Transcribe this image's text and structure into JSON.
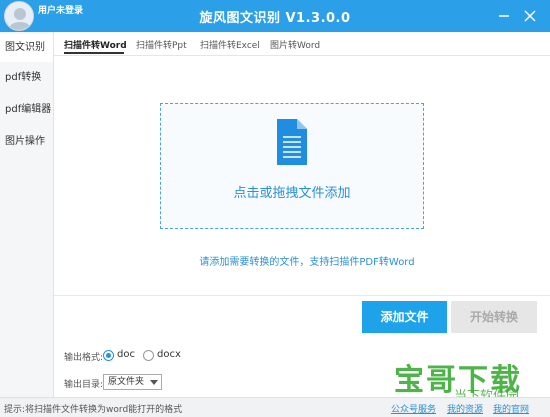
{
  "titlebar": {
    "user": "用户未登录",
    "title": "旋风图文识别 V1.3.0.0",
    "color": "#2b9fe8"
  },
  "sidebar": {
    "items": [
      {
        "label": "图文识别"
      },
      {
        "label": "pdf转换"
      },
      {
        "label": "pdf编辑器"
      },
      {
        "label": "图片操作"
      }
    ]
  },
  "tabs": [
    {
      "label": "扫描件转Word"
    },
    {
      "label": "扫描件转Ppt"
    },
    {
      "label": "扫描件转Excel"
    },
    {
      "label": "图片转Word"
    }
  ],
  "dropzone": {
    "label": "点击或拖拽文件添加",
    "icon": "document-icon"
  },
  "hint": "请添加需要转换的文件，支持扫描件PDF转Word",
  "buttons": {
    "add": "添加文件",
    "start": "开始转换"
  },
  "output": {
    "format_label": "输出格式:",
    "options": [
      "doc",
      "docx"
    ],
    "selected": "doc",
    "dir_label": "输出目录:",
    "dir_value": "原文件夹"
  },
  "status": {
    "text": "提示:将扫描件文件转换为word能打开的格式",
    "links": [
      "公众号服务",
      "我的资源",
      "我的官网"
    ]
  },
  "watermark": {
    "big": "宝哥下载",
    "small": "当下软件园"
  },
  "colors": {
    "accent": "#1ea3ea",
    "link": "#2b8fd6"
  }
}
